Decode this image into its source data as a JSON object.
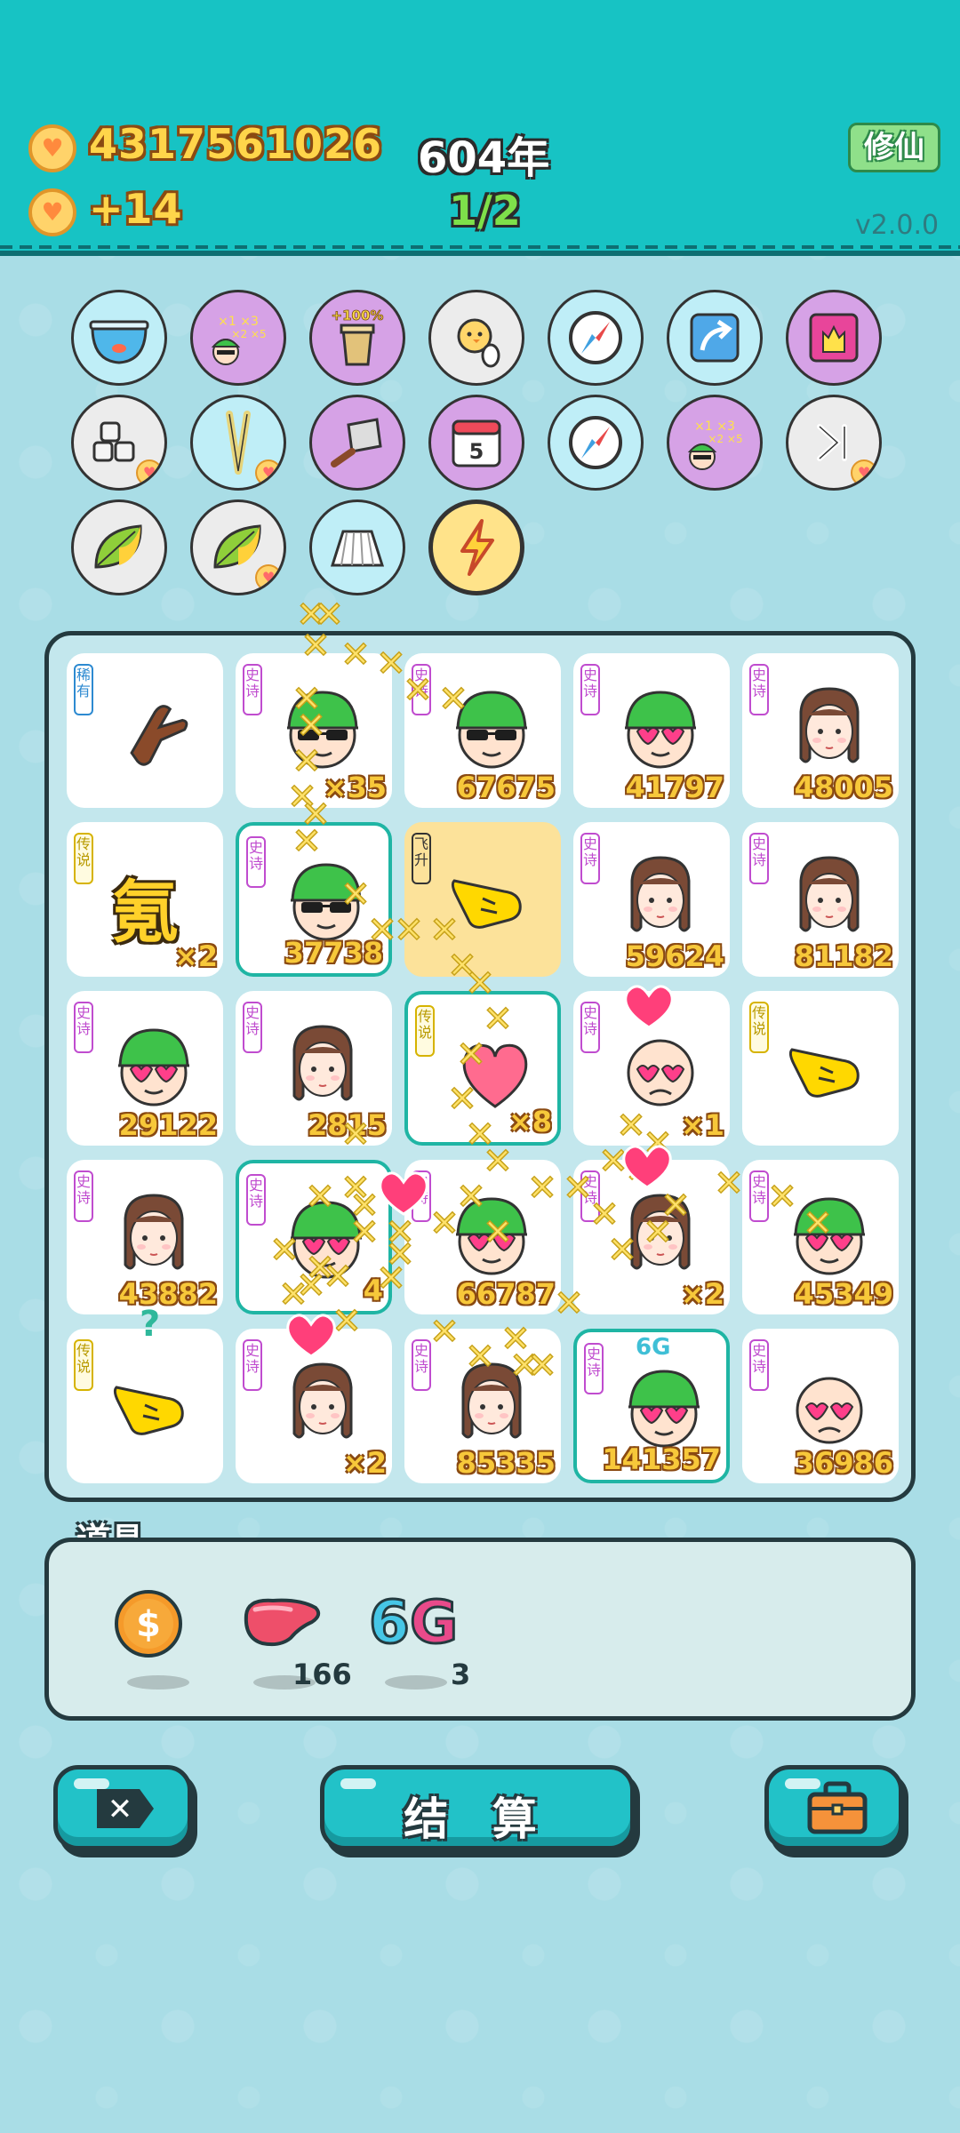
{
  "header": {
    "coins": "4317561026",
    "coin_rate": "+14",
    "year": "604年",
    "round_progress": "1/2",
    "xiuxian_button": "修仙",
    "version": "v2.0.0"
  },
  "items": [
    {
      "name": "fish-bowl-icon",
      "bg": "#bfeef7",
      "text": ""
    },
    {
      "name": "multiplier-face-icon",
      "bg": "#d6a2e6",
      "text": ""
    },
    {
      "name": "cup-plus-100-icon",
      "bg": "#d6a2e6",
      "text": "+100%"
    },
    {
      "name": "chick-egg-icon",
      "bg": "#ececec",
      "text": ""
    },
    {
      "name": "compass-icon",
      "bg": "#bfeef7",
      "text": ""
    },
    {
      "name": "arrow-card-icon",
      "bg": "#bfeef7",
      "text": ""
    },
    {
      "name": "pink-gift-icon",
      "bg": "#d6a2e6",
      "text": ""
    },
    {
      "name": "sugar-cubes-icon",
      "bg": "#ececec",
      "text": ""
    },
    {
      "name": "chopsticks-icon",
      "bg": "#bfeef7",
      "text": ""
    },
    {
      "name": "cleaver-icon",
      "bg": "#d6a2e6",
      "text": ""
    },
    {
      "name": "calendar-icon",
      "bg": "#d6a2e6",
      "text": "5"
    },
    {
      "name": "compass-icon",
      "bg": "#bfeef7",
      "text": ""
    },
    {
      "name": "multiplier-face-icon",
      "bg": "#d6a2e6",
      "text": ""
    },
    {
      "name": "skip-icon",
      "bg": "#ececec",
      "text": ""
    },
    {
      "name": "leaf-icon",
      "bg": "#ececec",
      "text": ""
    },
    {
      "name": "leaf-icon",
      "bg": "#ececec",
      "text": ""
    },
    {
      "name": "pleated-skirt-icon",
      "bg": "#bfeef7",
      "text": ""
    },
    {
      "name": "lightning-icon",
      "bg": "#ffe38a",
      "text": ""
    }
  ],
  "board": {
    "tags": {
      "epic": "史诗",
      "rare": "稀有",
      "legend": "传说",
      "fly": "飞升"
    },
    "cells": [
      {
        "tag": "rare",
        "art": "brown-hand",
        "value": ""
      },
      {
        "tag": "epic",
        "art": "green-hat-glasses",
        "value": "×35"
      },
      {
        "tag": "epic",
        "art": "green-hat-glasses",
        "value": "67675"
      },
      {
        "tag": "epic",
        "art": "green-hat-hearts",
        "value": "41797"
      },
      {
        "tag": "epic",
        "art": "braid-girl",
        "value": "48005"
      },
      {
        "tag": "legend",
        "art": "text-氪",
        "value": "×2"
      },
      {
        "tag": "epic",
        "art": "green-hat-glasses",
        "value": "37738",
        "selected": true
      },
      {
        "tag": "fly",
        "art": "yellow-hand",
        "value": "",
        "gold": true
      },
      {
        "tag": "epic",
        "art": "braid-girl",
        "value": "59624"
      },
      {
        "tag": "epic",
        "art": "braid-girl",
        "value": "81182"
      },
      {
        "tag": "epic",
        "art": "green-hat-hearts",
        "value": "29122"
      },
      {
        "tag": "epic",
        "art": "braid-girl",
        "value": "2815"
      },
      {
        "tag": "legend",
        "art": "heart-blob",
        "value": "×8",
        "selected": true
      },
      {
        "tag": "epic",
        "art": "bald-hearts",
        "value": "×1"
      },
      {
        "tag": "legend",
        "art": "yellow-hand",
        "value": ""
      },
      {
        "tag": "epic",
        "art": "braid-girl",
        "value": "43882"
      },
      {
        "tag": "epic",
        "art": "green-hat-hearts",
        "value": "4",
        "selected": true
      },
      {
        "tag": "epic",
        "art": "green-hat-hearts",
        "value": "66787"
      },
      {
        "tag": "epic",
        "art": "braid-girl",
        "value": "×2"
      },
      {
        "tag": "epic",
        "art": "green-hat-hearts",
        "value": "45349"
      },
      {
        "tag": "legend",
        "art": "yellow-hand",
        "value": ""
      },
      {
        "tag": "epic",
        "art": "braid-girl",
        "value": "×2"
      },
      {
        "tag": "epic",
        "art": "braid-girl",
        "value": "85335"
      },
      {
        "tag": "epic",
        "art": "green-hat-hearts",
        "value": "141357",
        "selected": true,
        "label": "6G"
      },
      {
        "tag": "epic",
        "art": "bald-hearts",
        "value": "36986"
      }
    ]
  },
  "tools": {
    "title": "道具",
    "items": [
      {
        "name": "dollar-coin-icon",
        "count": ""
      },
      {
        "name": "liver-icon",
        "count": "166"
      },
      {
        "name": "6g-icon",
        "label": "6G",
        "count": "3"
      }
    ]
  },
  "buttons": {
    "settle_label": "结 算"
  },
  "colors": {
    "header": "#17c3c4",
    "background": "#a9dde6",
    "value_gold": "#f7c83a",
    "epic": "#c04ccf",
    "legend": "#d6b300"
  }
}
